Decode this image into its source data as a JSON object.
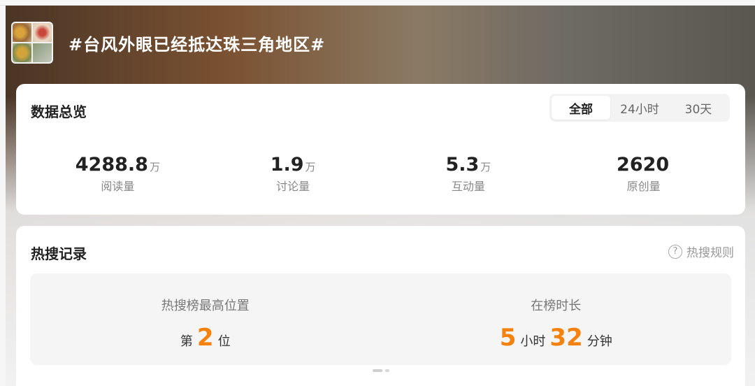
{
  "topic": {
    "title": "#台风外眼已经抵达珠三角地区#"
  },
  "overview": {
    "title": "数据总览",
    "tabs": [
      "全部",
      "24小时",
      "30天"
    ],
    "stats": [
      {
        "value": "4288.8",
        "unit": "万",
        "label": "阅读量"
      },
      {
        "value": "1.9",
        "unit": "万",
        "label": "讨论量"
      },
      {
        "value": "5.3",
        "unit": "万",
        "label": "互动量"
      },
      {
        "value": "2620",
        "unit": "",
        "label": "原创量"
      }
    ]
  },
  "hot": {
    "title": "热搜记录",
    "rule_label": "热搜规则",
    "peak": {
      "label": "热搜榜最高位置",
      "prefix": "第",
      "value": "2",
      "suffix": "位"
    },
    "duration": {
      "label": "在榜时长",
      "hours": "5",
      "hours_unit": "小时",
      "minutes": "32",
      "minutes_unit": "分钟"
    }
  },
  "colors": {
    "accent": "#f5820f"
  },
  "icons": {
    "thumbnail": "topic-thumbnail",
    "help": "question-icon"
  }
}
